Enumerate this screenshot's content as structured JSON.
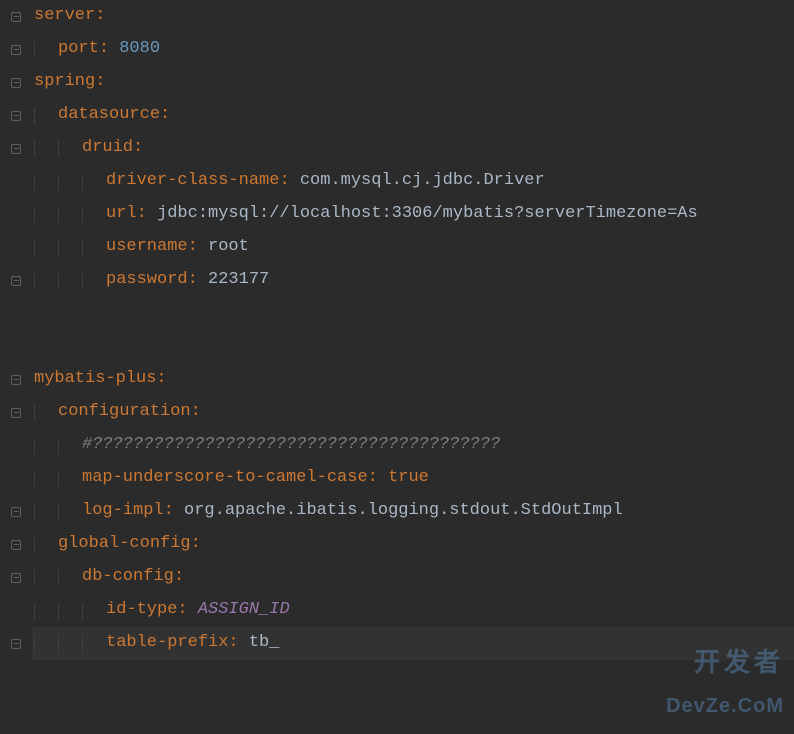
{
  "lines": [
    {
      "indent": 0,
      "fold": true,
      "key": "server",
      "value": null,
      "vtype": null
    },
    {
      "indent": 1,
      "fold": true,
      "key": "port",
      "value": "8080",
      "vtype": "num"
    },
    {
      "indent": 0,
      "fold": true,
      "key": "spring",
      "value": null,
      "vtype": null
    },
    {
      "indent": 1,
      "fold": true,
      "key": "datasource",
      "value": null,
      "vtype": null
    },
    {
      "indent": 2,
      "fold": true,
      "key": "druid",
      "value": null,
      "vtype": null
    },
    {
      "indent": 3,
      "fold": false,
      "key": "driver-class-name",
      "value": "com.mysql.cj.jdbc.Driver",
      "vtype": "str"
    },
    {
      "indent": 3,
      "fold": false,
      "key": "url",
      "value": "jdbc:mysql://localhost:3306/mybatis?serverTimezone=As",
      "vtype": "str"
    },
    {
      "indent": 3,
      "fold": false,
      "key": "username",
      "value": "root",
      "vtype": "str"
    },
    {
      "indent": 3,
      "fold": true,
      "key": "password",
      "value": "223177",
      "vtype": "str"
    },
    {
      "indent": 0,
      "fold": false,
      "key": null,
      "value": null,
      "vtype": null
    },
    {
      "indent": 0,
      "fold": false,
      "key": null,
      "value": null,
      "vtype": null
    },
    {
      "indent": 0,
      "fold": true,
      "key": "mybatis-plus",
      "value": null,
      "vtype": null
    },
    {
      "indent": 1,
      "fold": true,
      "key": "configuration",
      "value": null,
      "vtype": null
    },
    {
      "indent": 2,
      "fold": false,
      "key": null,
      "value": "#????????????????????????????????????????",
      "vtype": "comment"
    },
    {
      "indent": 2,
      "fold": false,
      "key": "map-underscore-to-camel-case",
      "value": "true",
      "vtype": "bool"
    },
    {
      "indent": 2,
      "fold": true,
      "key": "log-impl",
      "value": "org.apache.ibatis.logging.stdout.StdOutImpl",
      "vtype": "str"
    },
    {
      "indent": 1,
      "fold": true,
      "key": "global-config",
      "value": null,
      "vtype": null
    },
    {
      "indent": 2,
      "fold": true,
      "key": "db-config",
      "value": null,
      "vtype": null
    },
    {
      "indent": 3,
      "fold": false,
      "key": "id-type",
      "value": "ASSIGN_ID",
      "vtype": "italic"
    },
    {
      "indent": 3,
      "fold": true,
      "key": "table-prefix",
      "value": "tb_",
      "vtype": "str",
      "highlight": true
    },
    {
      "indent": 0,
      "fold": false,
      "key": null,
      "value": null,
      "vtype": null
    }
  ],
  "watermark": {
    "top": "开发者",
    "bottom": "DevZe.CoM"
  }
}
